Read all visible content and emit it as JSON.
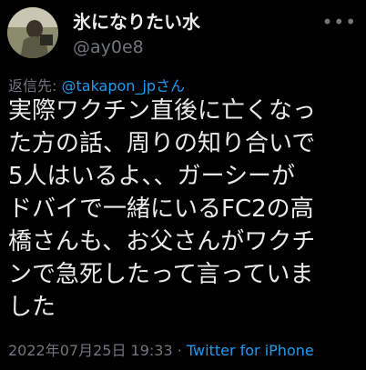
{
  "author": {
    "display_name": "氷になりたい水",
    "handle": "@ay0e8"
  },
  "reply_to": {
    "prefix": "返信先: ",
    "mention": "@takapon_jpさん"
  },
  "tweet": {
    "lines": [
      "実際ワクチン直後に亡くなっ",
      "た方の話、周りの知り合いで",
      "5人はいるよ、、ガーシーが",
      "ドバイで一緒にいるFC2の高",
      "橋さんも、お父さんがワクチ",
      "ンで急死したって言っていま",
      "した"
    ]
  },
  "meta": {
    "timestamp": "2022年07月25日 19:33",
    "separator": " · ",
    "source": "Twitter for iPhone"
  },
  "icons": {
    "more": "more-options-icon"
  },
  "colors": {
    "background": "#000000",
    "text": "#e7e9ea",
    "secondary": "#71767b",
    "accent": "#1d9bf0"
  }
}
